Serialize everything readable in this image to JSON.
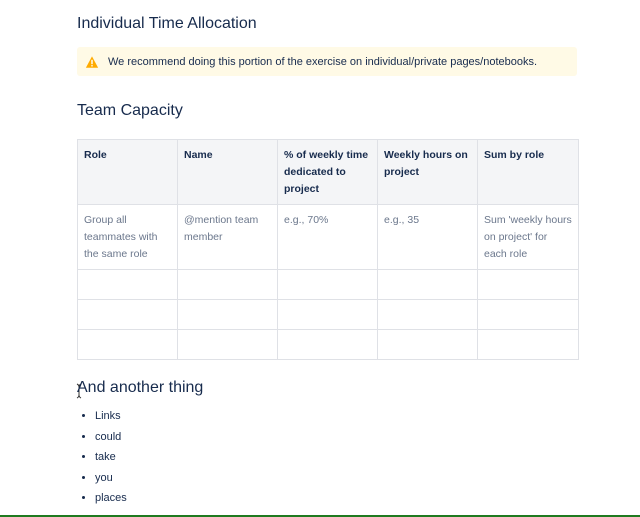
{
  "headings": {
    "time_allocation": "Individual Time Allocation",
    "team_capacity": "Team Capacity",
    "another_thing": "And another thing"
  },
  "panel": {
    "icon": "warning-icon",
    "text": "We recommend doing this portion of the exercise on individual/private pages/notebooks.",
    "background": "#fffae6",
    "icon_color": "#ffab00"
  },
  "table": {
    "headers": [
      "Role",
      "Name",
      "% of weekly time dedicated to project",
      "Weekly hours on project",
      "Sum by role"
    ],
    "hint_row": [
      "Group all teammates with the same role",
      "@mention team member",
      "e.g., 70%",
      "e.g., 35",
      "Sum 'weekly hours on project' for each role"
    ],
    "empty_rows": 3
  },
  "list": [
    "Links",
    "could",
    "take",
    "you",
    "places"
  ]
}
